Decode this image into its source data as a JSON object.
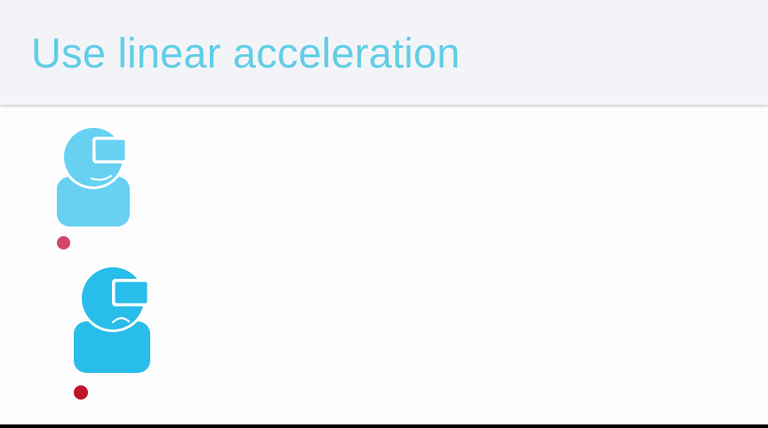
{
  "slide": {
    "title": "Use linear acceleration"
  },
  "figures": [
    {
      "name": "vr-user-happy",
      "icon": "vr-headset-user-icon",
      "expression": "smile",
      "body_color": "#68d1f2",
      "marker_color": "#d24766"
    },
    {
      "name": "vr-user-sad",
      "icon": "vr-headset-user-icon",
      "expression": "frown",
      "body_color": "#29bde9",
      "marker_color": "#c0142a"
    }
  ]
}
